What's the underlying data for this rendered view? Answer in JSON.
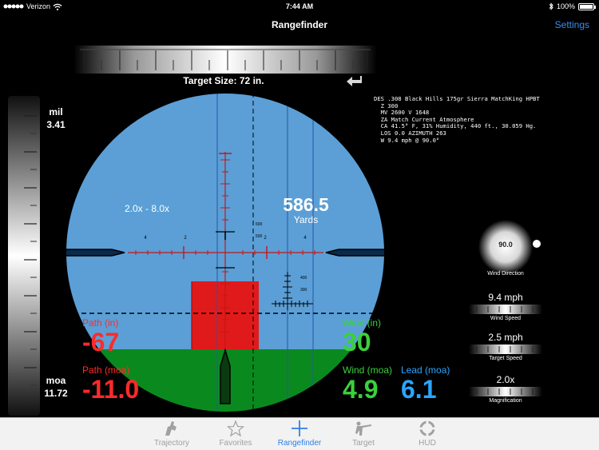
{
  "status_bar": {
    "signal_dots": 5,
    "carrier": "Verizon",
    "time": "7:44 AM",
    "battery_level": "100%"
  },
  "nav": {
    "title": "Rangefinder",
    "settings_label": "Settings"
  },
  "target_size": "Target Size: 72 in.",
  "left_scale": {
    "mil_label": "mil",
    "mil_value": "3.41",
    "moa_label": "moa",
    "moa_value": "11.72"
  },
  "scope": {
    "zoom_range": "2.0x - 8.0x",
    "distance_value": "586.5",
    "distance_unit": "Yards",
    "reticle_labels": [
      "4",
      "2",
      "2",
      "4"
    ],
    "small_labels": [
      "600",
      "500",
      "400",
      "300"
    ],
    "sky_color": "#5b9fd6",
    "ground_color": "#0a8a1e",
    "target_color": "#e01a1a"
  },
  "readouts": {
    "path_in_label": "Path (in)",
    "path_in_value": "-67",
    "path_moa_label": "Path (moa)",
    "path_moa_value": "-11.0",
    "wind_in_label": "Wind (in)",
    "wind_in_value": "30",
    "wind_moa_label": "Wind (moa)",
    "wind_moa_value": "4.9",
    "lead_moa_label": "Lead (moa)",
    "lead_moa_value": "6.1"
  },
  "colors": {
    "path": "#ff2a2a",
    "wind": "#3ad13a",
    "lead": "#2aa5ff",
    "accent": "#3a8ef0"
  },
  "info_lines": [
    "DES .308 Black Hills 175gr Sierra MatchKing HPBT",
    "  Z 300",
    "  MV 2600 V 1648",
    "  ZA Match Current Atmosphere",
    "  CA 41.5° F, 31% Humidity, 440 ft., 30.059 Hg.",
    "  LOS 0.0 AZIMUTH 263",
    "  W 9.4 mph @ 90.0°"
  ],
  "wind_direction": {
    "value": "90.0",
    "label": "Wind Direction"
  },
  "controls": [
    {
      "value": "9.4 mph",
      "label": "Wind Speed"
    },
    {
      "value": "2.5 mph",
      "label": "Target Speed"
    },
    {
      "value": "2.0x",
      "label": "Magnification"
    }
  ],
  "tabs": [
    {
      "label": "Trajectory",
      "icon": "trajectory-icon",
      "active": false
    },
    {
      "label": "Favorites",
      "icon": "star-icon",
      "active": false
    },
    {
      "label": "Rangefinder",
      "icon": "crosshair-icon",
      "active": true
    },
    {
      "label": "Target",
      "icon": "shooter-icon",
      "active": false
    },
    {
      "label": "HUD",
      "icon": "hud-icon",
      "active": false
    }
  ]
}
